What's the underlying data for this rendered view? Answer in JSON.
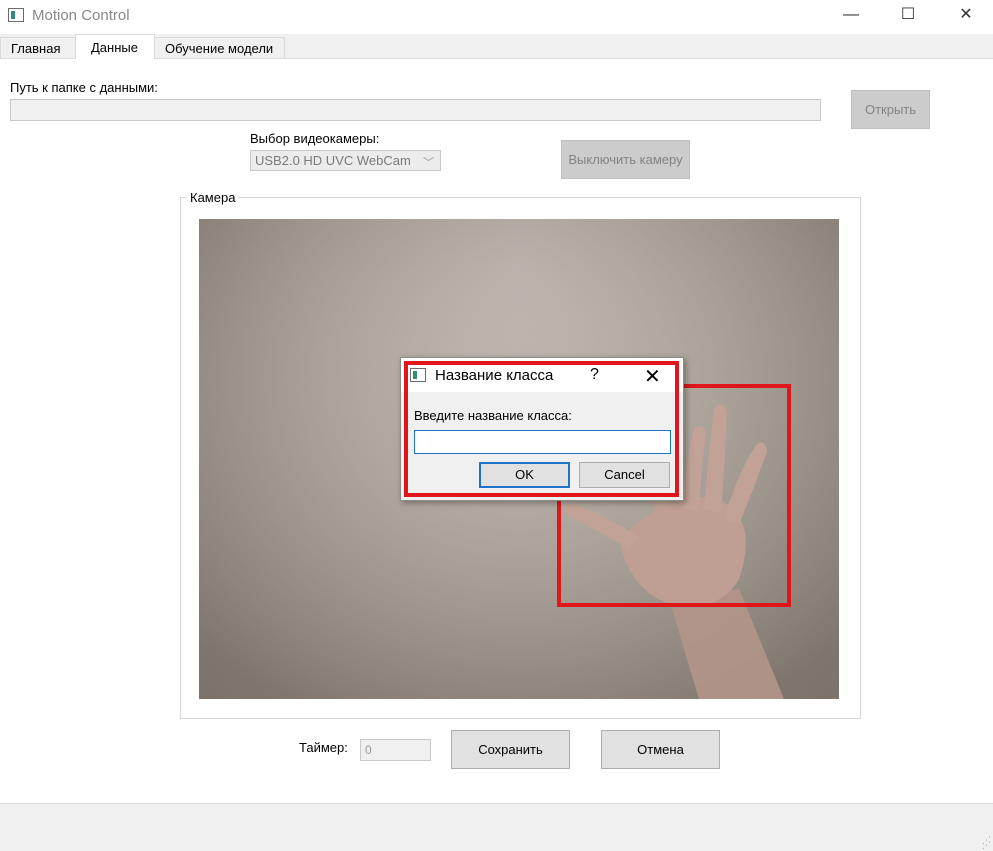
{
  "window": {
    "title": "Motion Control",
    "minimize_glyph": "—",
    "maximize_glyph": "☐",
    "close_glyph": "✕"
  },
  "tabs": [
    {
      "label": "Главная",
      "active": false
    },
    {
      "label": "Данные",
      "active": true
    },
    {
      "label": "Обучение модели",
      "active": false
    }
  ],
  "data_tab": {
    "path_label": "Путь к папке с данными:",
    "path_value": "",
    "open_button": "Открыть",
    "camera_select_label": "Выбор видеокамеры:",
    "camera_selected": "USB2.0 HD UVC WebCam",
    "camera_toggle_button": "Выключить камеру",
    "camera_group_label": "Камера",
    "timer_label": "Таймер:",
    "timer_value": "0",
    "save_button": "Сохранить",
    "cancel_button": "Отмена"
  },
  "dialog": {
    "title": "Название класса",
    "help_glyph": "?",
    "close_glyph": "✕",
    "prompt": "Введите название класса:",
    "input_value": "",
    "ok_button": "OK",
    "cancel_button": "Cancel"
  },
  "colors": {
    "highlight": "#e0161b",
    "focus_border": "#1e73c8"
  },
  "icons": [
    "app-icon",
    "chevron-down-icon",
    "help-icon",
    "close-icon",
    "size-grip-icon"
  ]
}
